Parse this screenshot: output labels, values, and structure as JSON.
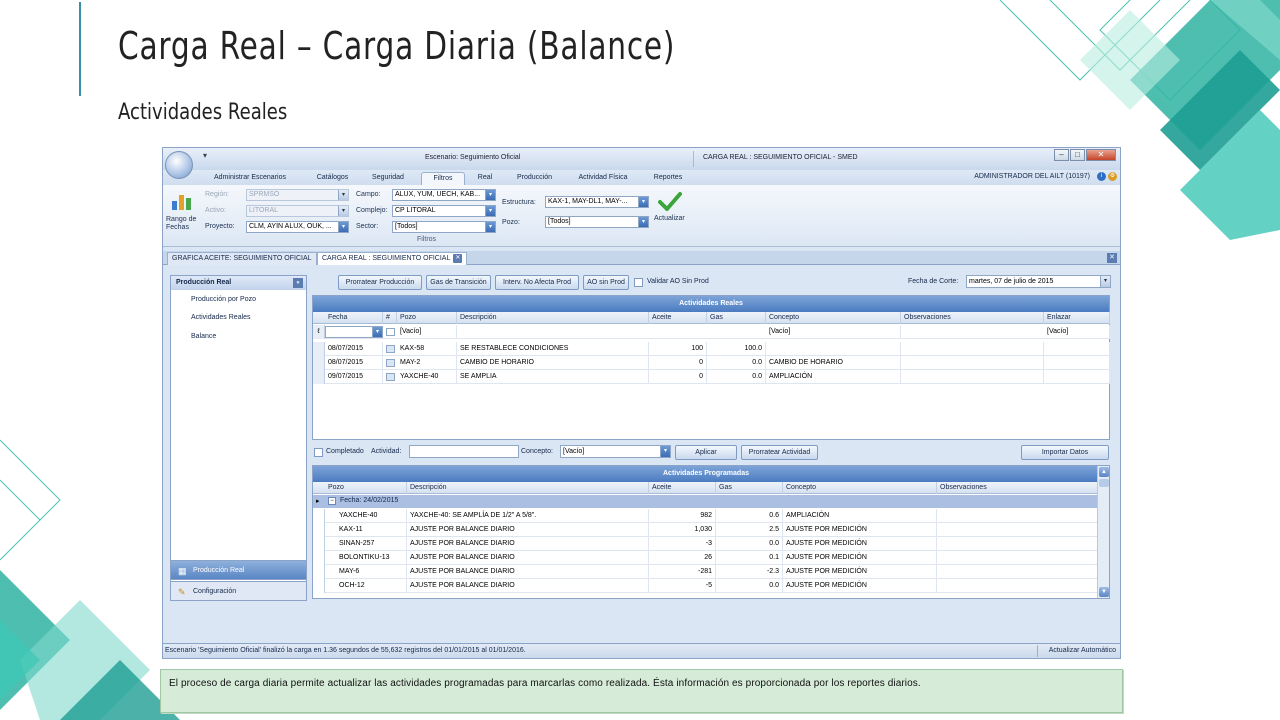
{
  "slide": {
    "title": "Carga Real – Carga Diaria (Balance)",
    "subtitle": "Actividades Reales",
    "caption": "El proceso de carga diaria permite actualizar las actividades programadas para marcarlas como realizada. Ésta información es proporcionada por los reportes diarios."
  },
  "app": {
    "scenario_label": "Escenario: Seguimiento Oficial",
    "window_title": "CARGA REAL : SEGUIMIENTO OFICIAL - SMED",
    "user": "ADMINISTRADOR DEL AILT (10197)",
    "tabs": [
      {
        "label": "Administrar Escenarios"
      },
      {
        "label": "Catálogos"
      },
      {
        "label": "Seguridad"
      },
      {
        "label": "Filtros"
      },
      {
        "label": "Real"
      },
      {
        "label": "Producción"
      },
      {
        "label": "Actividad Física"
      },
      {
        "label": "Reportes"
      }
    ],
    "ribbon": {
      "range_label": "Rango de Fechas",
      "region_label": "Región:",
      "region_value": "SPRMSO",
      "activo_label": "Activo:",
      "activo_value": "LITORAL",
      "proyecto_label": "Proyecto:",
      "proyecto_value": "CLM, AYIN ALUX, OUK, ...",
      "campo_label": "Campo:",
      "campo_value": "ALUX, YUM, UECH, KAB...",
      "complejo_label": "Complejo:",
      "complejo_value": "CP LITORAL",
      "sector_label": "Sector:",
      "sector_value": "[Todos]",
      "estructura_label": "Estructura:",
      "estructura_value": "KAX-1, MAY-DL1, MAY-...",
      "pozo_label": "Pozo:",
      "pozo_value": "[Todos]",
      "actualizar_label": "Actualizar",
      "group_label": "Filtros"
    },
    "doc_tabs": [
      {
        "label": "GRAFICA ACEITE: SEGUIMIENTO OFICIAL"
      },
      {
        "label": "CARGA REAL : SEGUIMIENTO OFICIAL"
      }
    ],
    "sidebar": {
      "header": "Producción Real",
      "items": [
        "Producción por Pozo",
        "Actividades Reales",
        "Balance"
      ],
      "nav": [
        {
          "label": "Producción Real"
        },
        {
          "label": "Configuración"
        }
      ]
    },
    "toolbar": {
      "prorratear_prod": "Prorratear Producción",
      "gas_transicion": "Gas de Transición",
      "interv": "Interv. No Afecta Prod",
      "ao_sin_prod": "AO sin Prod",
      "validar_ao": "Validar AO Sin Prod",
      "fecha_corte_label": "Fecha de Corte:",
      "fecha_corte_value": "martes, 07 de julio de 2015"
    },
    "reales": {
      "caption": "Actividades Reales",
      "headers": [
        "Fecha",
        "#",
        "Pozo",
        "Descripción",
        "Aceite",
        "Gas",
        "Concepto",
        "Observaciones",
        "Enlazar"
      ],
      "filter": {
        "pozo": "[Vacío]",
        "concepto": "[Vacío]",
        "enlazar": "[Vacío]"
      },
      "rows": [
        {
          "fecha": "08/07/2015",
          "pozo": "KAX-58",
          "descripcion": "SE RESTABLECE CONDICIONES",
          "aceite": "100",
          "gas": "100.0",
          "concepto": ""
        },
        {
          "fecha": "08/07/2015",
          "pozo": "MAY-2",
          "descripcion": "CAMBIO DE HORARIO",
          "aceite": "0",
          "gas": "0.0",
          "concepto": "CAMBIO DE HORARIO"
        },
        {
          "fecha": "09/07/2015",
          "pozo": "YAXCHE-40",
          "descripcion": "SE AMPLIA",
          "aceite": "0",
          "gas": "0.0",
          "concepto": "AMPLIACIÓN"
        }
      ]
    },
    "mid_toolbar": {
      "completado": "Completado",
      "actividad_label": "Actividad:",
      "concepto_label": "Concepto:",
      "concepto_value": "[Vacío]",
      "aplicar": "Aplicar",
      "prorratear_actividad": "Prorratear Actividad",
      "importar": "Importar Datos"
    },
    "programadas": {
      "caption": "Actividades Programadas",
      "headers": [
        "Pozo",
        "Descripción",
        "Aceite",
        "Gas",
        "Concepto",
        "Observaciones"
      ],
      "group": "Fecha: 24/02/2015",
      "rows": [
        {
          "pozo": "YAXCHE-40",
          "descripcion": "YAXCHE-40: SE AMPLÍA DE 1/2\" A 5/8\".",
          "aceite": "982",
          "gas": "0.6",
          "concepto": "AMPLIACIÓN"
        },
        {
          "pozo": "KAX-11",
          "descripcion": "AJUSTE POR BALANCE DIARIO",
          "aceite": "1,030",
          "gas": "2.5",
          "concepto": "AJUSTE POR MEDICIÓN"
        },
        {
          "pozo": "SINAN-257",
          "descripcion": "AJUSTE POR BALANCE DIARIO",
          "aceite": "-3",
          "gas": "0.0",
          "concepto": "AJUSTE POR MEDICIÓN"
        },
        {
          "pozo": "BOLONTIKU-13",
          "descripcion": "AJUSTE POR BALANCE DIARIO",
          "aceite": "26",
          "gas": "0.1",
          "concepto": "AJUSTE POR MEDICIÓN"
        },
        {
          "pozo": "MAY-6",
          "descripcion": "AJUSTE POR BALANCE DIARIO",
          "aceite": "-281",
          "gas": "-2.3",
          "concepto": "AJUSTE POR MEDICIÓN"
        },
        {
          "pozo": "OCH-12",
          "descripcion": "AJUSTE POR BALANCE DIARIO",
          "aceite": "-5",
          "gas": "0.0",
          "concepto": "AJUSTE POR MEDICIÓN"
        }
      ]
    },
    "status": "Escenario 'Seguimiento Oficial' finalizó la carga en 1.36 segundos de 55,632 registros del 01/01/2015 al 01/01/2016.",
    "status_right": "Actualizar Automático"
  }
}
